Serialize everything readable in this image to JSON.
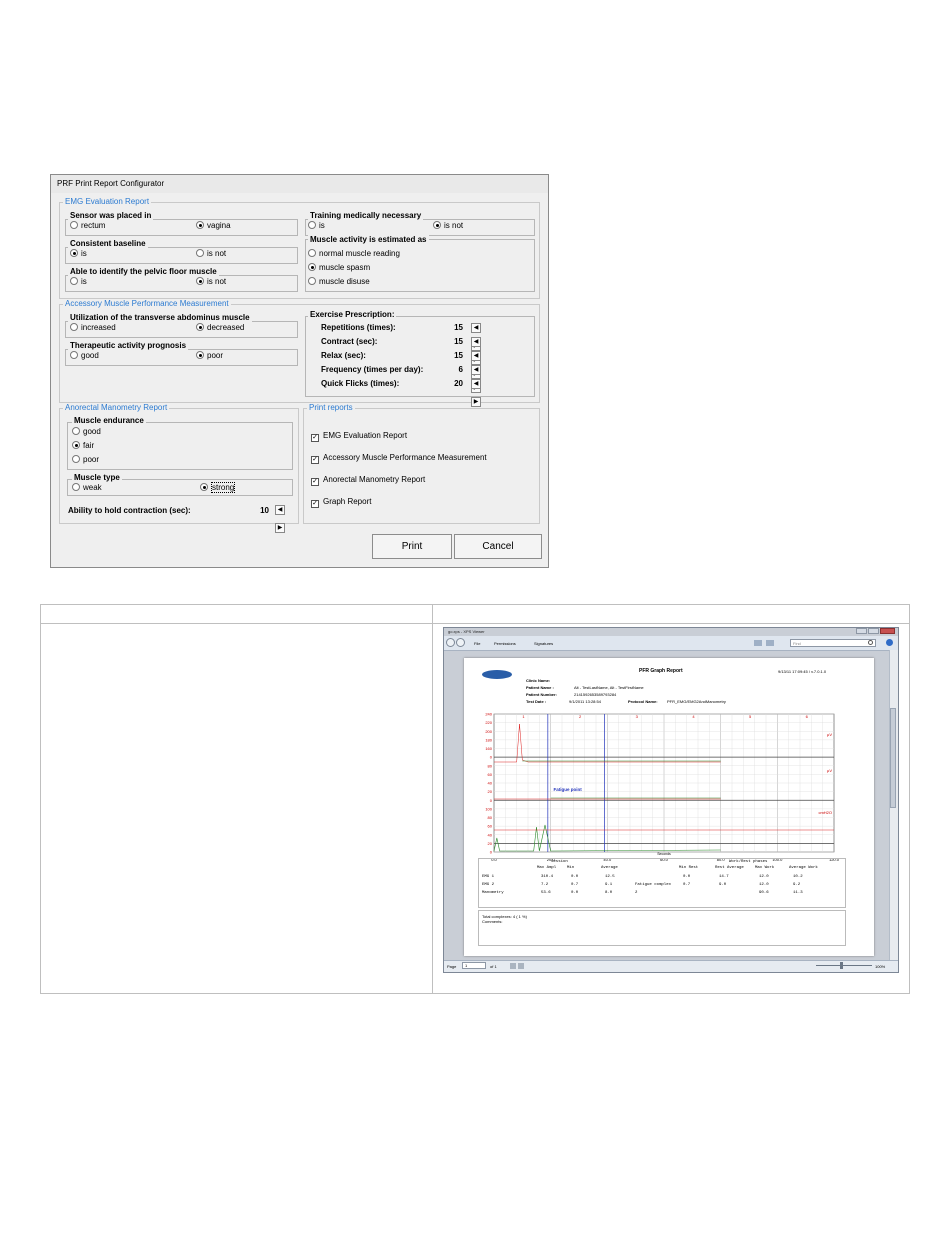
{
  "dialog": {
    "title": "PRF Print Report Configurator",
    "emg": {
      "label": "EMG Evaluation Report",
      "sensor": {
        "label": "Sensor was placed in",
        "options": [
          "rectum",
          "vagina"
        ],
        "selected": "vagina"
      },
      "baseline": {
        "label": "Consistent baseline",
        "options": [
          "is",
          "is not"
        ],
        "selected": "is"
      },
      "identify": {
        "label": "Able to identify the pelvic floor muscle",
        "options": [
          "is",
          "is not"
        ],
        "selected": "is not"
      },
      "training": {
        "label": "Training medically necessary",
        "options": [
          "is",
          "is not"
        ],
        "selected": "is not"
      },
      "activity": {
        "label": "Muscle activity is estimated as",
        "options": [
          "normal muscle reading",
          "muscle spasm",
          "muscle disuse"
        ],
        "selected": "muscle spasm"
      }
    },
    "accessory": {
      "label": "Accessory Muscle Performance Measurement",
      "abdominus": {
        "label": "Utilization of the transverse abdominus muscle",
        "options": [
          "increased",
          "decreased"
        ],
        "selected": "decreased"
      },
      "prognosis": {
        "label": "Therapeutic activity prognosis",
        "options": [
          "good",
          "poor"
        ],
        "selected": "poor"
      },
      "exercise": {
        "label": "Exercise Prescription:",
        "rows": [
          {
            "label": "Repetitions (times):",
            "value": "15"
          },
          {
            "label": "Contract (sec):",
            "value": "15"
          },
          {
            "label": "Relax (sec):",
            "value": "15"
          },
          {
            "label": "Frequency (times per day):",
            "value": "6"
          },
          {
            "label": "Quick Flicks (times):",
            "value": "20"
          }
        ]
      }
    },
    "anorectal": {
      "label": "Anorectal Manometry Report",
      "endurance": {
        "label": "Muscle endurance",
        "options": [
          "good",
          "fair",
          "poor"
        ],
        "selected": "fair"
      },
      "type": {
        "label": "Muscle type",
        "options": [
          "weak",
          "strong"
        ],
        "selected": "strong"
      },
      "hold": {
        "label": "Ability to hold contraction (sec):",
        "value": "10"
      }
    },
    "print_reports": {
      "label": "Print reports",
      "items": [
        {
          "label": "EMG Evaluation Report",
          "checked": true
        },
        {
          "label": "Accessory Muscle Performance Measurement",
          "checked": true
        },
        {
          "label": "Anorectal Manometry Report",
          "checked": true
        },
        {
          "label": "Graph Report",
          "checked": true
        }
      ]
    },
    "buttons": {
      "print": "Print",
      "cancel": "Cancel"
    }
  },
  "viewer": {
    "title": "go.xps - XPS Viewer",
    "menu": [
      "File",
      "Permissions",
      "Signatures"
    ],
    "search_placeholder": "Find",
    "report": {
      "title": "PFR Graph Report",
      "stamp": "9/13/11 17:09:45 / v.7.0.1.0",
      "fields": [
        {
          "label": "Clinic Name:",
          "value": ""
        },
        {
          "label": "Patient Name :",
          "value": "Alt - TestLastName, Alt - TestFirstName"
        },
        {
          "label": "Patient Number:",
          "value": "2141592653589793284"
        },
        {
          "label": "Test Date :",
          "value": "9/1/2011 13:28:54"
        }
      ],
      "protocol": {
        "label": "Protocol Name:",
        "value": "PFR_EMG/EMG2AndManometry"
      },
      "phase_markers": [
        "1",
        "2",
        "3",
        "4",
        "5",
        "6"
      ],
      "fatigue_label": "Fatigue point",
      "unit_labels": [
        "µV",
        "µV",
        "cmH2O"
      ],
      "x_axis_title": "Seconds",
      "y_ticks": [
        "240",
        "220",
        "200",
        "180",
        "160",
        "0",
        "80",
        "60",
        "40",
        "20",
        "0",
        "100",
        "80",
        "60",
        "40",
        "20",
        "0"
      ],
      "chart_data": {
        "type": "line",
        "x_ticks": [
          "0.0",
          "20.0",
          "40.0",
          "60.0",
          "80.0",
          "100.0",
          "120.0"
        ],
        "xlabel": "Seconds",
        "xlim": [
          0,
          120
        ]
      },
      "table": {
        "group_headers": [
          "Session",
          "Work/Rest phases"
        ],
        "columns": [
          "Max Ampl",
          "Min",
          "Average",
          "",
          "Min Rest",
          "Rest Average",
          "Max Work",
          "Average Work"
        ],
        "rows": [
          {
            "name": "EMG 1",
            "cells": [
              "310.4",
              "0.0",
              "12.5",
              "",
              "0.0",
              "14.7",
              "12.0",
              "10.2"
            ]
          },
          {
            "name": "EMG 2",
            "cells": [
              "7.2",
              "0.7",
              "9.1",
              "Fatigue complex",
              "0.7",
              "9.0",
              "12.0",
              "9.2"
            ]
          },
          {
            "name": "Manometry",
            "cells": [
              "53.6",
              "0.0",
              "8.0",
              "2",
              "",
              "",
              "90.6",
              "11.3"
            ]
          }
        ]
      },
      "notes": [
        "Total complexes: 4 ( 1 %)",
        "Comments:"
      ]
    },
    "status": {
      "page_label": "Page",
      "page_value": "1",
      "of_label": "of 1",
      "zoom": "100%"
    }
  }
}
